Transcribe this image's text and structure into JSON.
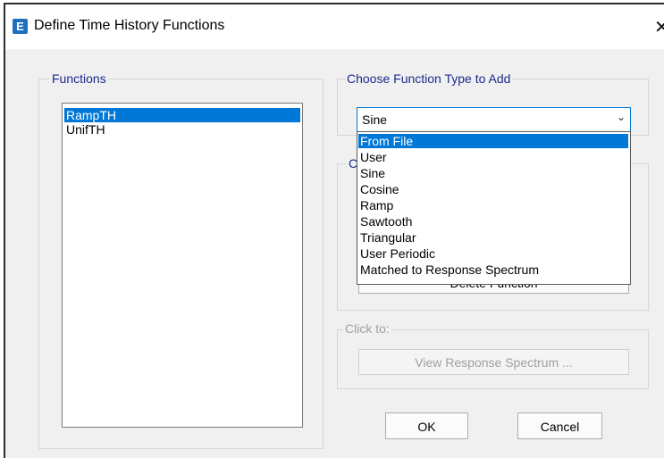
{
  "window": {
    "title": "Define Time History Functions",
    "app_icon_letter": "E",
    "close_glyph": "✕"
  },
  "functions": {
    "legend": "Functions",
    "items": [
      "RampTH",
      "UnifTH"
    ],
    "selected": "RampTH"
  },
  "choose_type": {
    "legend": "Choose  Function Type to Add",
    "selected_value": "Sine",
    "options": [
      "From File",
      "User",
      "Sine",
      "Cosine",
      "Ramp",
      "Sawtooth",
      "Triangular",
      "User Periodic",
      "Matched to Response Spectrum"
    ],
    "highlighted": "From File"
  },
  "click_to_partial": {
    "legend_fragment": "C",
    "delete_button_partial": "Delete Function"
  },
  "click_to": {
    "legend": "Click to:",
    "view_button": "View Response Spectrum ..."
  },
  "buttons": {
    "ok": "OK",
    "cancel": "Cancel"
  },
  "colors": {
    "accent": "#0078d7",
    "legend_blue": "#1a2a8c",
    "disabled_gray": "#a0a0a0"
  }
}
